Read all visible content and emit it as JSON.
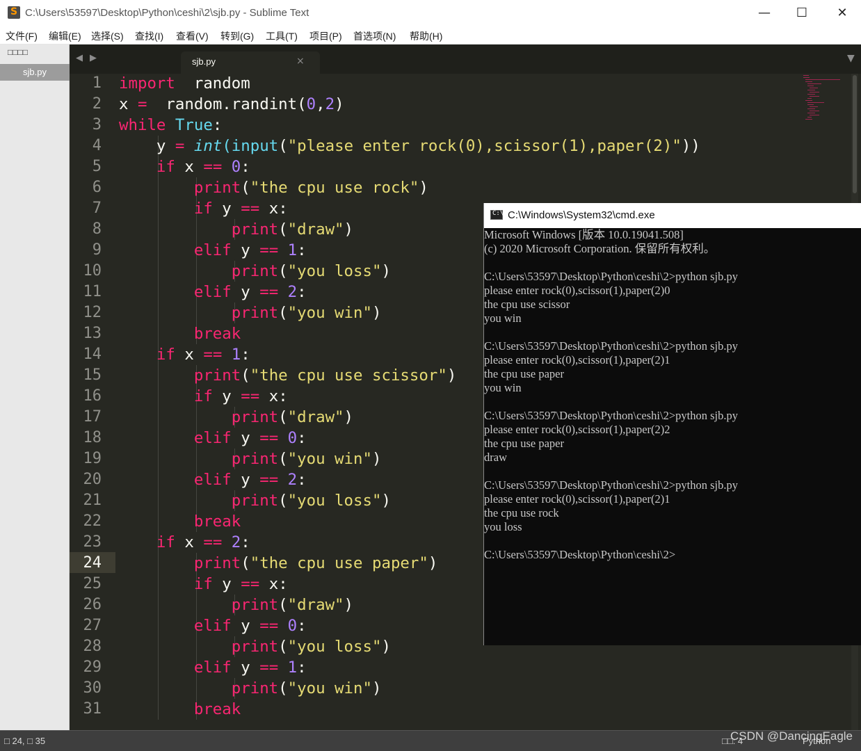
{
  "window": {
    "title": "C:\\Users\\53597\\Desktop\\Python\\ceshi\\2\\sjb.py - Sublime Text",
    "minimize": "—",
    "maximize": "☐",
    "close": "✕"
  },
  "menu": [
    "文件(F)",
    "编辑(E)",
    "选择(S)",
    "查找(I)",
    "查看(V)",
    "转到(G)",
    "工具(T)",
    "项目(P)",
    "首选项(N)",
    "帮助(H)"
  ],
  "sidebar": {
    "header": "□□□□",
    "open_file": "sjb.py"
  },
  "tabs": [
    {
      "label": "sjb.py",
      "close": "×"
    }
  ],
  "editor": {
    "active_line": 24,
    "lines": [
      [
        [
          "kw",
          "import"
        ],
        [
          "",
          "  random"
        ]
      ],
      [
        [
          "",
          "x "
        ],
        [
          "kw",
          "="
        ],
        [
          "",
          "  random.randint("
        ],
        [
          "num",
          "0"
        ],
        [
          "",
          ","
        ],
        [
          "num",
          "2"
        ],
        [
          "",
          ")"
        ]
      ],
      [
        [
          "kw",
          "while"
        ],
        [
          "",
          " "
        ],
        [
          "bi",
          "True"
        ],
        [
          "",
          ":"
        ]
      ],
      [
        [
          "",
          "    y "
        ],
        [
          "kw",
          "="
        ],
        [
          "",
          " "
        ],
        [
          "it",
          "int"
        ],
        [
          "bi",
          "(input"
        ],
        [
          "",
          "("
        ],
        [
          "str",
          "\"please enter rock(0),scissor(1),paper(2)\""
        ],
        [
          "",
          "))"
        ]
      ],
      [
        [
          "",
          "    "
        ],
        [
          "kw",
          "if"
        ],
        [
          "",
          " x "
        ],
        [
          "kw",
          "=="
        ],
        [
          "",
          " "
        ],
        [
          "num",
          "0"
        ],
        [
          "",
          ":"
        ]
      ],
      [
        [
          "",
          "        "
        ],
        [
          "kw",
          "print"
        ],
        [
          "",
          "("
        ],
        [
          "str",
          "\"the cpu use rock\""
        ],
        [
          "",
          ")"
        ]
      ],
      [
        [
          "",
          "        "
        ],
        [
          "kw",
          "if"
        ],
        [
          "",
          " y "
        ],
        [
          "kw",
          "=="
        ],
        [
          "",
          " x:"
        ]
      ],
      [
        [
          "",
          "            "
        ],
        [
          "kw",
          "print"
        ],
        [
          "",
          "("
        ],
        [
          "str",
          "\"draw\""
        ],
        [
          "",
          ")"
        ]
      ],
      [
        [
          "",
          "        "
        ],
        [
          "kw",
          "elif"
        ],
        [
          "",
          " y "
        ],
        [
          "kw",
          "=="
        ],
        [
          "",
          " "
        ],
        [
          "num",
          "1"
        ],
        [
          "",
          ":"
        ]
      ],
      [
        [
          "",
          "            "
        ],
        [
          "kw",
          "print"
        ],
        [
          "",
          "("
        ],
        [
          "str",
          "\"you loss\""
        ],
        [
          "",
          ")"
        ]
      ],
      [
        [
          "",
          "        "
        ],
        [
          "kw",
          "elif"
        ],
        [
          "",
          " y "
        ],
        [
          "kw",
          "=="
        ],
        [
          "",
          " "
        ],
        [
          "num",
          "2"
        ],
        [
          "",
          ":"
        ]
      ],
      [
        [
          "",
          "            "
        ],
        [
          "kw",
          "print"
        ],
        [
          "",
          "("
        ],
        [
          "str",
          "\"you win\""
        ],
        [
          "",
          ")"
        ]
      ],
      [
        [
          "",
          "        "
        ],
        [
          "kw",
          "break"
        ]
      ],
      [
        [
          "",
          "    "
        ],
        [
          "kw",
          "if"
        ],
        [
          "",
          " x "
        ],
        [
          "kw",
          "=="
        ],
        [
          "",
          " "
        ],
        [
          "num",
          "1"
        ],
        [
          "",
          ":"
        ]
      ],
      [
        [
          "",
          "        "
        ],
        [
          "kw",
          "print"
        ],
        [
          "",
          "("
        ],
        [
          "str",
          "\"the cpu use scissor\""
        ],
        [
          "",
          ")"
        ]
      ],
      [
        [
          "",
          "        "
        ],
        [
          "kw",
          "if"
        ],
        [
          "",
          " y "
        ],
        [
          "kw",
          "=="
        ],
        [
          "",
          " x:"
        ]
      ],
      [
        [
          "",
          "            "
        ],
        [
          "kw",
          "print"
        ],
        [
          "",
          "("
        ],
        [
          "str",
          "\"draw\""
        ],
        [
          "",
          ")"
        ]
      ],
      [
        [
          "",
          "        "
        ],
        [
          "kw",
          "elif"
        ],
        [
          "",
          " y "
        ],
        [
          "kw",
          "=="
        ],
        [
          "",
          " "
        ],
        [
          "num",
          "0"
        ],
        [
          "",
          ":"
        ]
      ],
      [
        [
          "",
          "            "
        ],
        [
          "kw",
          "print"
        ],
        [
          "",
          "("
        ],
        [
          "str",
          "\"you win\""
        ],
        [
          "",
          ")"
        ]
      ],
      [
        [
          "",
          "        "
        ],
        [
          "kw",
          "elif"
        ],
        [
          "",
          " y "
        ],
        [
          "kw",
          "=="
        ],
        [
          "",
          " "
        ],
        [
          "num",
          "2"
        ],
        [
          "",
          ":"
        ]
      ],
      [
        [
          "",
          "            "
        ],
        [
          "kw",
          "print"
        ],
        [
          "",
          "("
        ],
        [
          "str",
          "\"you loss\""
        ],
        [
          "",
          ")"
        ]
      ],
      [
        [
          "",
          "        "
        ],
        [
          "kw",
          "break"
        ]
      ],
      [
        [
          "",
          "    "
        ],
        [
          "kw",
          "if"
        ],
        [
          "",
          " x "
        ],
        [
          "kw",
          "=="
        ],
        [
          "",
          " "
        ],
        [
          "num",
          "2"
        ],
        [
          "",
          ":"
        ]
      ],
      [
        [
          "",
          "        "
        ],
        [
          "kw",
          "print"
        ],
        [
          "",
          "("
        ],
        [
          "str",
          "\"the cpu use paper\""
        ],
        [
          "",
          ")"
        ]
      ],
      [
        [
          "",
          "        "
        ],
        [
          "kw",
          "if"
        ],
        [
          "",
          " y "
        ],
        [
          "kw",
          "=="
        ],
        [
          "",
          " x:"
        ]
      ],
      [
        [
          "",
          "            "
        ],
        [
          "kw",
          "print"
        ],
        [
          "",
          "("
        ],
        [
          "str",
          "\"draw\""
        ],
        [
          "",
          ")"
        ]
      ],
      [
        [
          "",
          "        "
        ],
        [
          "kw",
          "elif"
        ],
        [
          "",
          " y "
        ],
        [
          "kw",
          "=="
        ],
        [
          "",
          " "
        ],
        [
          "num",
          "0"
        ],
        [
          "",
          ":"
        ]
      ],
      [
        [
          "",
          "            "
        ],
        [
          "kw",
          "print"
        ],
        [
          "",
          "("
        ],
        [
          "str",
          "\"you loss\""
        ],
        [
          "",
          ")"
        ]
      ],
      [
        [
          "",
          "        "
        ],
        [
          "kw",
          "elif"
        ],
        [
          "",
          " y "
        ],
        [
          "kw",
          "=="
        ],
        [
          "",
          " "
        ],
        [
          "num",
          "1"
        ],
        [
          "",
          ":"
        ]
      ],
      [
        [
          "",
          "            "
        ],
        [
          "kw",
          "print"
        ],
        [
          "",
          "("
        ],
        [
          "str",
          "\"you win\""
        ],
        [
          "",
          ")"
        ]
      ],
      [
        [
          "",
          "        "
        ],
        [
          "kw",
          "break"
        ]
      ]
    ]
  },
  "statusbar": {
    "position": "□ 24, □ 35",
    "tab_size": "□□: 4",
    "syntax": "Python"
  },
  "watermark": "CSDN @DancingEagle",
  "cmd": {
    "title": "C:\\Windows\\System32\\cmd.exe",
    "icon_text": "C:\\.",
    "lines": [
      "Microsoft Windows [版本 10.0.19041.508]",
      "(c) 2020 Microsoft Corporation. 保留所有权利。",
      "",
      "C:\\Users\\53597\\Desktop\\Python\\ceshi\\2>python sjb.py",
      "please enter rock(0),scissor(1),paper(2)0",
      "the cpu use scissor",
      "you win",
      "",
      "C:\\Users\\53597\\Desktop\\Python\\ceshi\\2>python sjb.py",
      "please enter rock(0),scissor(1),paper(2)1",
      "the cpu use paper",
      "you win",
      "",
      "C:\\Users\\53597\\Desktop\\Python\\ceshi\\2>python sjb.py",
      "please enter rock(0),scissor(1),paper(2)2",
      "the cpu use paper",
      "draw",
      "",
      "C:\\Users\\53597\\Desktop\\Python\\ceshi\\2>python sjb.py",
      "please enter rock(0),scissor(1),paper(2)1",
      "the cpu use rock",
      "you loss",
      "",
      "C:\\Users\\53597\\Desktop\\Python\\ceshi\\2>"
    ]
  }
}
